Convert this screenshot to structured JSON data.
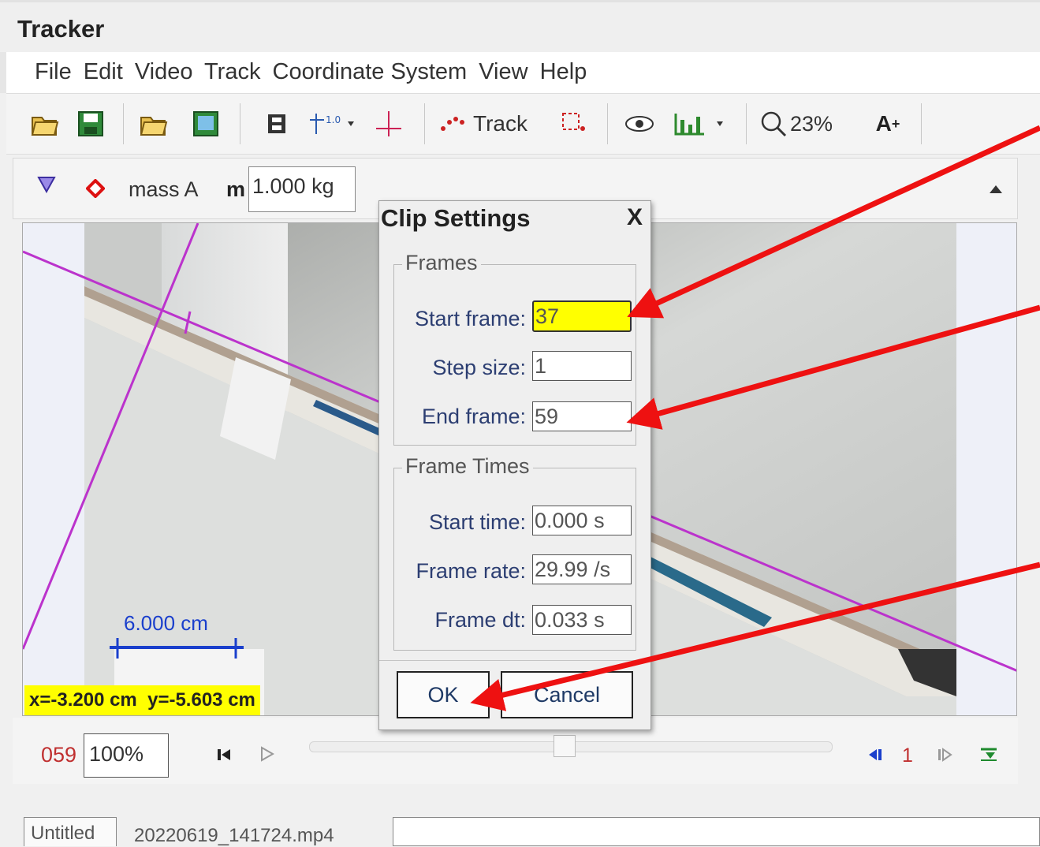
{
  "app": {
    "title": "Tracker"
  },
  "menu": [
    "File",
    "Edit",
    "Video",
    "Track",
    "Coordinate System",
    "View",
    "Help"
  ],
  "toolbar": {
    "track_label": "Track",
    "zoom": "23%",
    "font_size_label": "A",
    "font_size_sup": "+"
  },
  "trackbar": {
    "track_name": "mass A",
    "mass_label": "m",
    "mass_value": "1.000 kg"
  },
  "video": {
    "scale_label": "6.000 cm",
    "coords_readout": "x=-3.200 cm  y=-5.603 cm"
  },
  "player": {
    "frame_number": "059",
    "zoom_value": "100%",
    "step_value": "1"
  },
  "bottom_tabs": [
    "Untitled",
    "20220619_141724.mp4"
  ],
  "dialog": {
    "title": "Clip Settings",
    "close": "X",
    "frames_group": "Frames",
    "start_frame_label": "Start frame:",
    "start_frame_value": "37",
    "step_size_label": "Step size:",
    "step_size_value": "1",
    "end_frame_label": "End frame:",
    "end_frame_value": "59",
    "times_group": "Frame Times",
    "start_time_label": "Start time:",
    "start_time_value": "0.000 s",
    "frame_rate_label": "Frame rate:",
    "frame_rate_value": "29.99 /s",
    "frame_dt_label": "Frame dt:",
    "frame_dt_value": "0.033 s",
    "ok_label": "OK",
    "cancel_label": "Cancel"
  },
  "colors": {
    "highlight": "#ffff00",
    "track_line": "#bb33cc",
    "annotation_arrow": "#ee1111",
    "scale_bar": "#1a3fcc"
  }
}
